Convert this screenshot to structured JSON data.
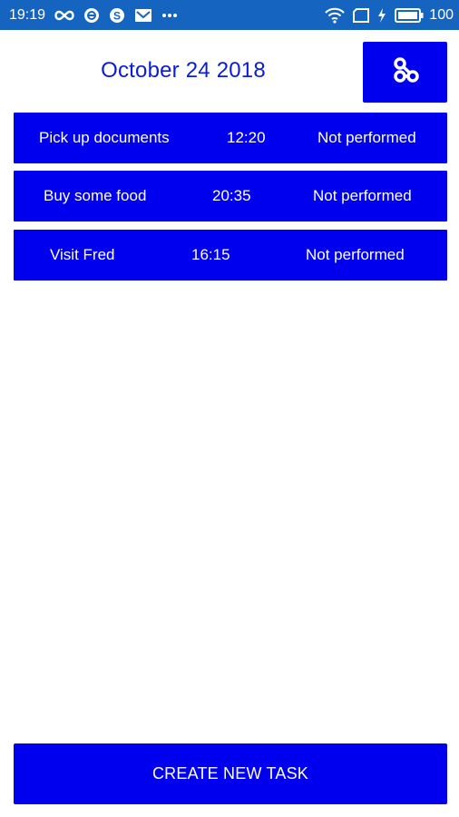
{
  "status_bar": {
    "time": "19:19",
    "left_icons": [
      "infinity-icon",
      "sync-icon",
      "skype-icon",
      "mail-icon",
      "more-dots-icon"
    ],
    "right_icons": [
      "wifi-icon",
      "sim-icon",
      "charging-icon",
      "battery-icon"
    ],
    "battery": "100"
  },
  "header": {
    "date": "October 24 2018",
    "hub_icon": "network-hub-icon"
  },
  "tasks": [
    {
      "name": "Pick up documents",
      "time": "12:20",
      "status": "Not performed"
    },
    {
      "name": "Buy some food",
      "time": "20:35",
      "status": "Not performed"
    },
    {
      "name": "Visit Fred",
      "time": "16:15",
      "status": "Not performed"
    }
  ],
  "actions": {
    "create_label": "CREATE NEW TASK"
  },
  "colors": {
    "accent": "#0000ee",
    "status_bar": "#1565c0",
    "date_text": "#0b1cd6"
  }
}
